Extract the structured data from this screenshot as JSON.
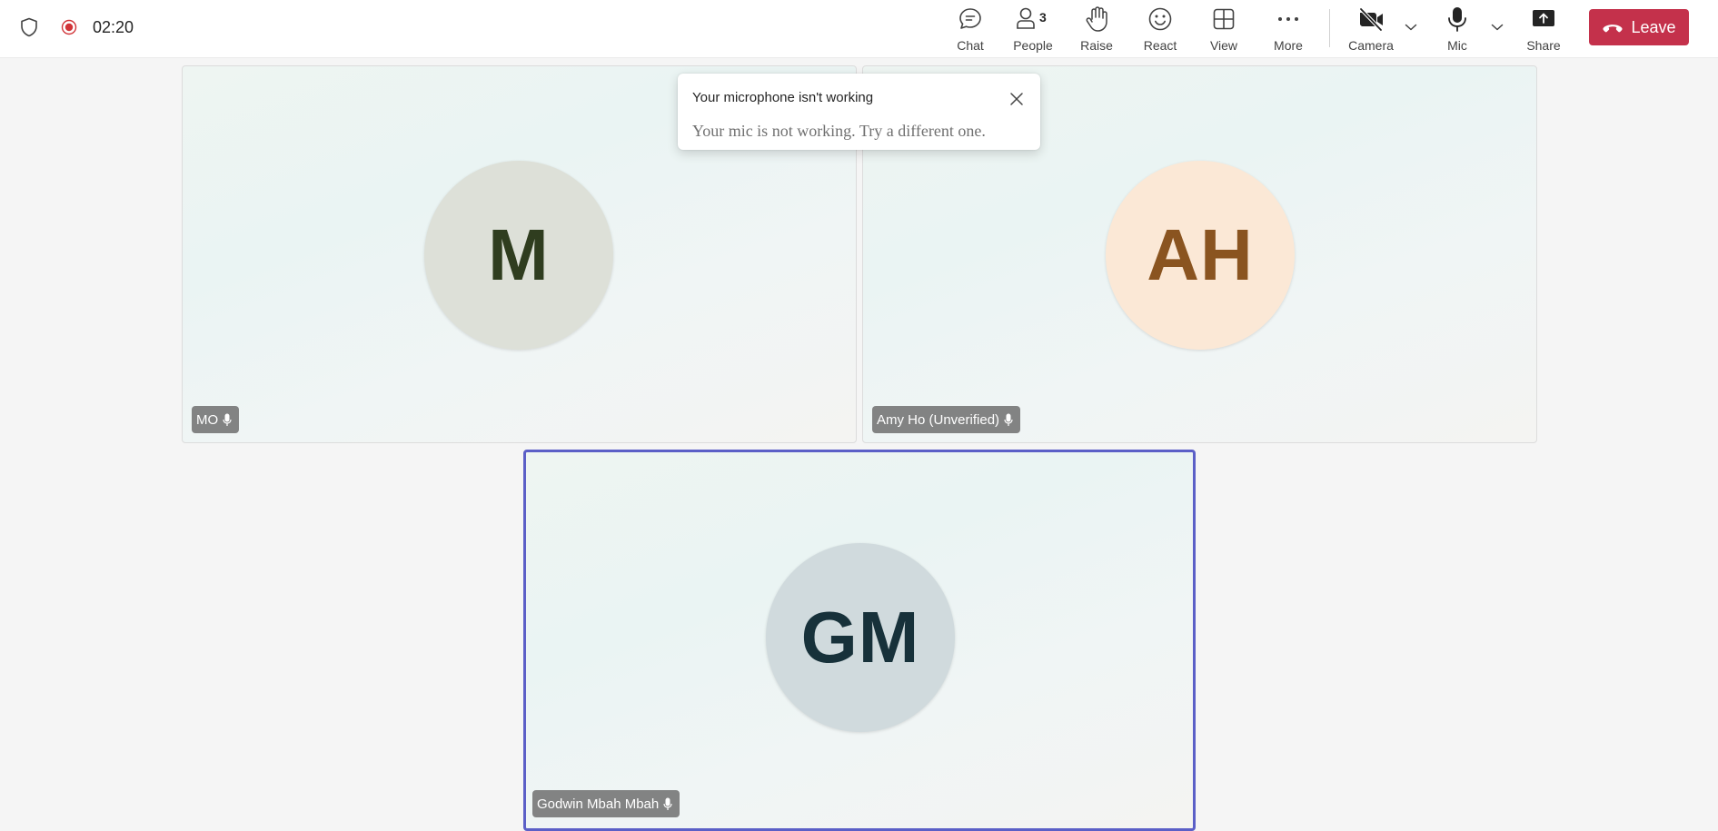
{
  "header": {
    "timer": "02:20",
    "recording_color": "#d13438"
  },
  "toolbar": {
    "chat_label": "Chat",
    "people_label": "People",
    "people_count": "3",
    "raise_label": "Raise",
    "react_label": "React",
    "view_label": "View",
    "more_label": "More",
    "camera_label": "Camera",
    "mic_label": "Mic",
    "share_label": "Share",
    "leave_label": "Leave",
    "leave_color": "#c4314b"
  },
  "toast": {
    "title": "Your microphone isn't working",
    "body": "Your mic is not working. Try a different one."
  },
  "participants": [
    {
      "initials": "M",
      "name": "MO",
      "avatar_bg": "#dde0d8",
      "initials_color": "#2f3d1f"
    },
    {
      "initials": "AH",
      "name": "Amy Ho (Unverified)",
      "avatar_bg": "#fbe8d6",
      "initials_color": "#8a5420"
    },
    {
      "initials": "GM",
      "name": "Godwin Mbah Mbah",
      "avatar_bg": "#d0dadd",
      "initials_color": "#17313a",
      "active": true
    }
  ],
  "accent_color": "#5b5fc7"
}
